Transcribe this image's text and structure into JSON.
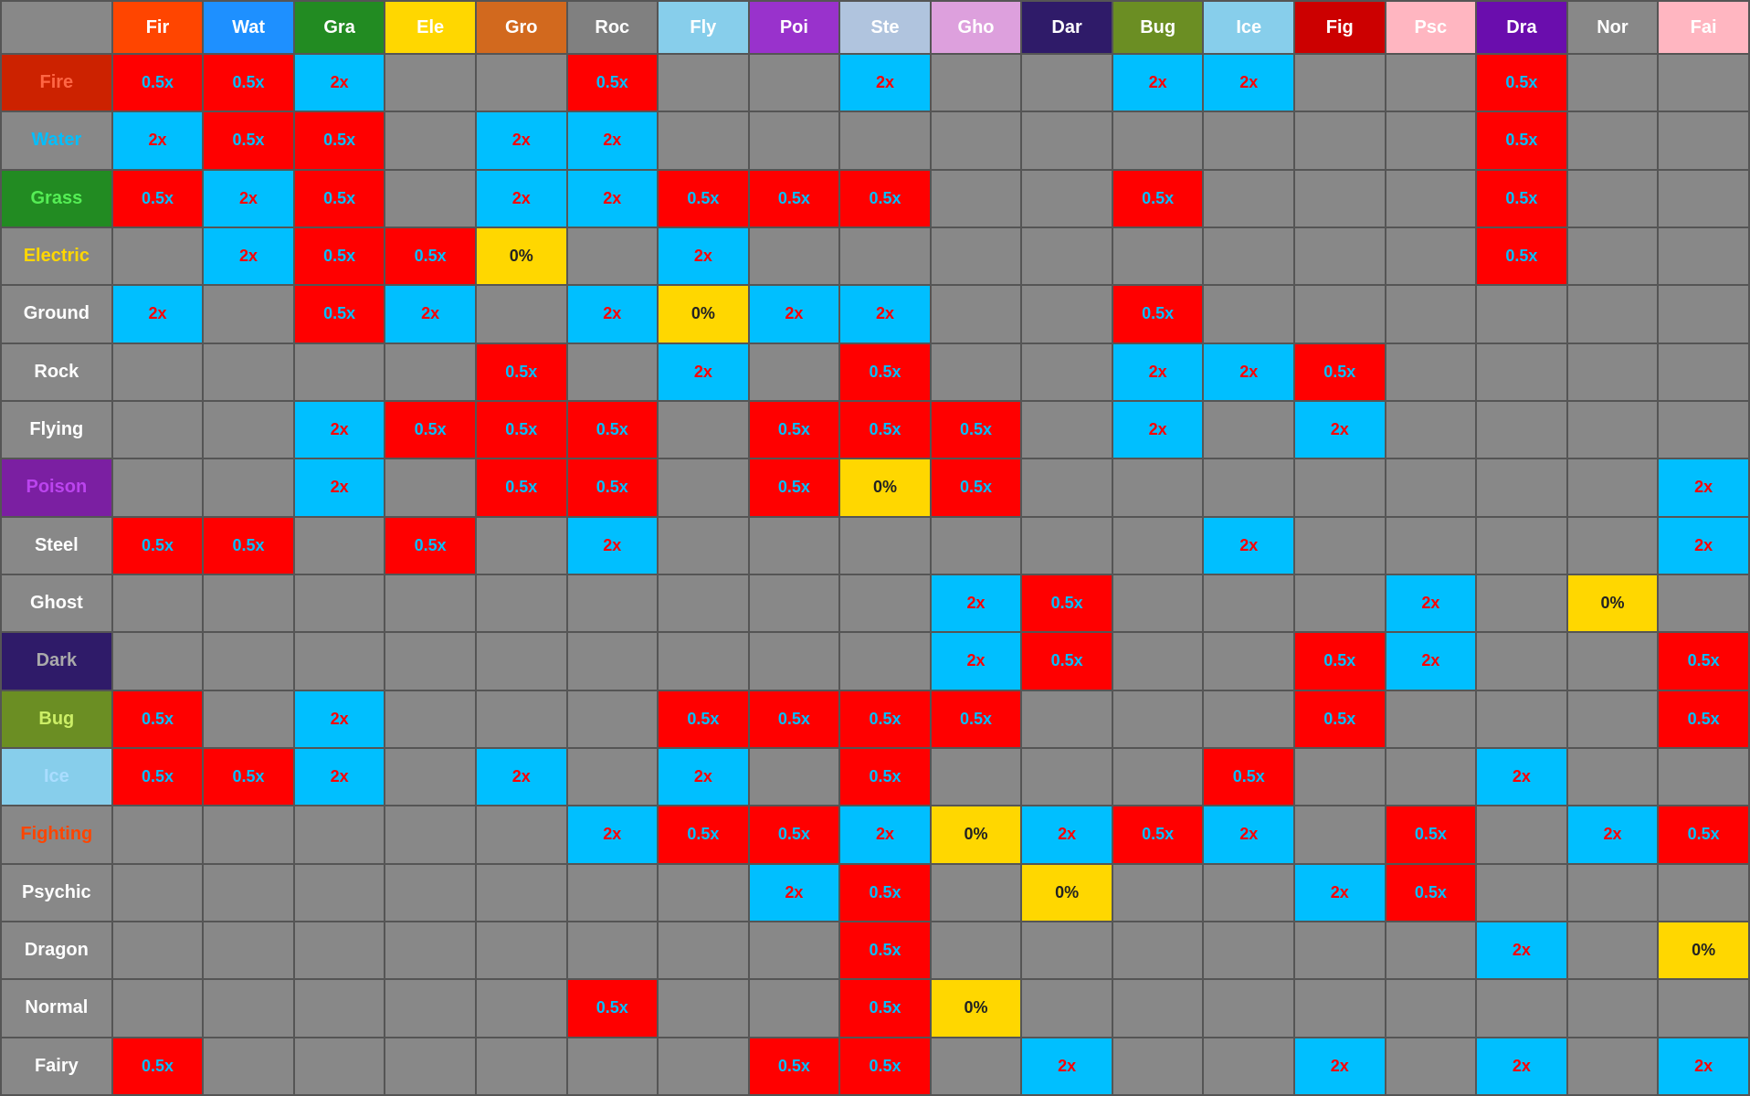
{
  "headers": {
    "corner": "",
    "cols": [
      {
        "label": "Fir",
        "class": "h-fir"
      },
      {
        "label": "Wat",
        "class": "h-wat"
      },
      {
        "label": "Gra",
        "class": "h-gra"
      },
      {
        "label": "Ele",
        "class": "h-ele"
      },
      {
        "label": "Gro",
        "class": "h-gro"
      },
      {
        "label": "Roc",
        "class": "h-roc"
      },
      {
        "label": "Fly",
        "class": "h-fly"
      },
      {
        "label": "Poi",
        "class": "h-poi"
      },
      {
        "label": "Ste",
        "class": "h-ste"
      },
      {
        "label": "Gho",
        "class": "h-gho"
      },
      {
        "label": "Dar",
        "class": "h-dar"
      },
      {
        "label": "Bug",
        "class": "h-bug"
      },
      {
        "label": "Ice",
        "class": "h-ice"
      },
      {
        "label": "Fig",
        "class": "h-fig"
      },
      {
        "label": "Psc",
        "class": "h-psc"
      },
      {
        "label": "Dra",
        "class": "h-dra"
      },
      {
        "label": "Nor",
        "class": "h-nor"
      },
      {
        "label": "Fai",
        "class": "h-fai"
      }
    ]
  },
  "rows": [
    {
      "label": "Fire",
      "labelColor": "#ff4500",
      "labelBg": "#ff4500",
      "cells": [
        "0.5x:r",
        "0.5x:r",
        "2x:b",
        "",
        "",
        "0.5x:r",
        "",
        "",
        "2x:b",
        "",
        "",
        "2x:b",
        "2x:b",
        "",
        "",
        "0.5x:r",
        "",
        ""
      ]
    },
    {
      "label": "Water",
      "labelColor": "#00bfff",
      "labelBg": "transparent",
      "cells": [
        "2x:b",
        "0.5x:r",
        "0.5x:r",
        "",
        "2x:b",
        "2x:b",
        "",
        "",
        "",
        "",
        "",
        "",
        "",
        "",
        "",
        "0.5x:r",
        "",
        ""
      ]
    },
    {
      "label": "Grass",
      "labelColor": "#32cd32",
      "labelBg": "#32cd32",
      "cells": [
        "0.5x:r",
        "2x:b",
        "0.5x:r",
        "",
        "2x:b",
        "2x:b",
        "0.5x:r",
        "0.5x:r",
        "0.5x:r",
        "",
        "",
        "0.5x:r",
        "",
        "",
        "",
        "0.5x:r",
        "",
        ""
      ]
    },
    {
      "label": "Electric",
      "labelColor": "#ffd700",
      "labelBg": "#ffd700",
      "cells": [
        "",
        "2x:b",
        "0.5x:r",
        "0.5x:r",
        "0%",
        "",
        "2x:b",
        "",
        "",
        "",
        "",
        "",
        "",
        "",
        "",
        "0.5x:r",
        "",
        ""
      ]
    },
    {
      "label": "Ground",
      "labelColor": "white",
      "labelBg": "transparent",
      "cells": [
        "2x:b",
        "",
        "0.5x:r",
        "2x:b",
        "",
        "2x:b",
        "0%",
        "2x:b",
        "2x:b",
        "",
        "",
        "0.5x:r",
        "",
        "",
        "",
        "",
        "",
        ""
      ]
    },
    {
      "label": "Rock",
      "labelColor": "white",
      "labelBg": "transparent",
      "cells": [
        "",
        "",
        "",
        "",
        "0.5x:r",
        "",
        "2x:b",
        "",
        "0.5x:r",
        "",
        "",
        "2x:b",
        "2x:b",
        "0.5x:r",
        "",
        "",
        "",
        ""
      ]
    },
    {
      "label": "Flying",
      "labelColor": "white",
      "labelBg": "transparent",
      "cells": [
        "",
        "",
        "2x:b",
        "0.5x:r",
        "0.5x:r",
        "0.5x:r",
        "",
        "0.5x:r",
        "0.5x:r",
        "0.5x:r",
        "",
        "2x:b",
        "",
        "2x:b",
        "",
        "",
        "",
        ""
      ]
    },
    {
      "label": "Poison",
      "labelColor": "#9932cc",
      "labelBg": "#9932cc",
      "cells": [
        "",
        "",
        "2x:b",
        "",
        "0.5x:r",
        "0.5x:r",
        "",
        "0.5x:r",
        "0%",
        "0.5x:r",
        "",
        "",
        "",
        "",
        "",
        "",
        "",
        "2x:b"
      ]
    },
    {
      "label": "Steel",
      "labelColor": "white",
      "labelBg": "transparent",
      "cells": [
        "0.5x:r",
        "0.5x:r",
        "",
        "0.5x:r",
        "",
        "2x:b",
        "",
        "",
        "",
        "",
        "",
        "",
        "2x:b",
        "",
        "",
        "",
        "",
        "2x:b"
      ]
    },
    {
      "label": "Ghost",
      "labelColor": "white",
      "labelBg": "transparent",
      "cells": [
        "",
        "",
        "",
        "",
        "",
        "",
        "",
        "",
        "",
        "2x:b",
        "0.5x:r",
        "",
        "",
        "",
        "2x:b",
        "",
        "0%",
        ""
      ]
    },
    {
      "label": "Dark",
      "labelColor": "white",
      "labelBg": "#2f1b69",
      "cells": [
        "",
        "",
        "",
        "",
        "",
        "",
        "",
        "",
        "",
        "2x:b",
        "0.5x:r",
        "",
        "",
        "0.5x:r",
        "2x:b",
        "",
        "",
        "0.5x:r"
      ]
    },
    {
      "label": "Bug",
      "labelColor": "white",
      "labelBg": "#6b8e23",
      "cells": [
        "0.5x:r",
        "",
        "2x:b",
        "",
        "",
        "",
        "0.5x:r",
        "0.5x:r",
        "0.5x:r",
        "0.5x:r",
        "",
        "",
        "",
        "0.5x:r",
        "",
        "",
        "",
        "0.5x:r"
      ]
    },
    {
      "label": "Ice",
      "labelColor": "white",
      "labelBg": "#87ceeb",
      "cells": [
        "0.5x:r",
        "0.5x:r",
        "2x:b",
        "",
        "2x:b",
        "",
        "2x:b",
        "",
        "0.5x:r",
        "",
        "",
        "",
        "0.5x:r",
        "",
        "",
        "2x:b",
        "",
        ""
      ]
    },
    {
      "label": "Fighting",
      "labelColor": "#ff4500",
      "labelBg": "transparent",
      "cells": [
        "",
        "",
        "",
        "",
        "",
        "2x:b",
        "0.5x:r",
        "0.5x:r",
        "2x:b",
        "0%",
        "2x:b",
        "0.5x:r",
        "2x:b",
        "",
        "0.5x:r",
        "",
        "2x:b",
        "0.5x:r"
      ]
    },
    {
      "label": "Psychic",
      "labelColor": "white",
      "labelBg": "transparent",
      "cells": [
        "",
        "",
        "",
        "",
        "",
        "",
        "",
        "2x:b",
        "0.5x:r",
        "",
        "0%",
        "",
        "",
        "2x:b",
        "0.5x:r",
        "",
        "",
        ""
      ]
    },
    {
      "label": "Dragon",
      "labelColor": "white",
      "labelBg": "transparent",
      "cells": [
        "",
        "",
        "",
        "",
        "",
        "",
        "",
        "",
        "0.5x:r",
        "",
        "",
        "",
        "",
        "",
        "",
        "2x:b",
        "",
        "0%"
      ]
    },
    {
      "label": "Normal",
      "labelColor": "white",
      "labelBg": "transparent",
      "cells": [
        "",
        "",
        "",
        "",
        "",
        "0.5x:r",
        "",
        "",
        "0.5x:r",
        "0%",
        "",
        "",
        "",
        "",
        "",
        "",
        "",
        ""
      ]
    },
    {
      "label": "Fairy",
      "labelColor": "white",
      "labelBg": "transparent",
      "cells": [
        "0.5x:r",
        "",
        "",
        "",
        "",
        "",
        "",
        "0.5x:r",
        "0.5x:r",
        "",
        "2x:b",
        "",
        "",
        "2x:b",
        "",
        "2x:b",
        "",
        "2x:b"
      ]
    }
  ]
}
